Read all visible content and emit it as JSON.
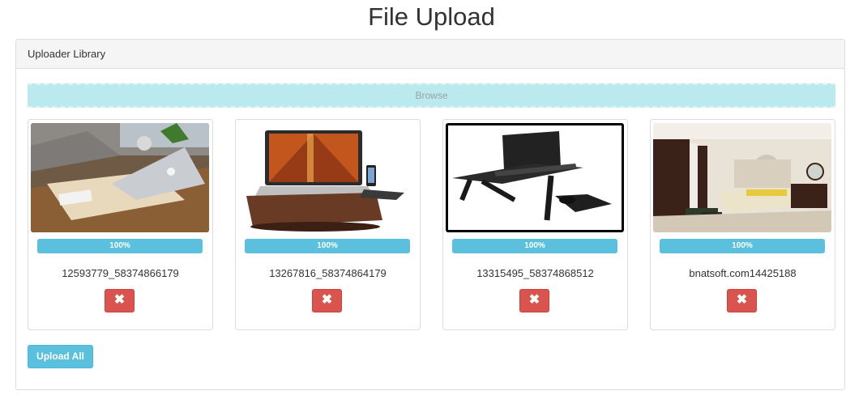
{
  "page": {
    "title": "File Upload"
  },
  "panel": {
    "heading": "Uploader Library",
    "browse_label": "Browse"
  },
  "files": [
    {
      "name": "12593779_58374866179",
      "progress_text": "100%",
      "progress": 1.0,
      "remove_icon": "✖",
      "image": "laptop-on-wooden-desk-photo"
    },
    {
      "name": "13267816_58374864179",
      "progress_text": "100%",
      "progress": 1.0,
      "remove_icon": "✖",
      "image": "laptop-lap-desk-photo"
    },
    {
      "name": "13315495_58374868512",
      "progress_text": "100%",
      "progress": 1.0,
      "remove_icon": "✖",
      "image": "laptop-stand-table-photo"
    },
    {
      "name": "bnatsoft.com14425188",
      "progress_text": "100%",
      "progress": 1.0,
      "remove_icon": "✖",
      "image": "bedroom-interior-photo"
    }
  ],
  "actions": {
    "upload_all_label": "Upload All"
  }
}
